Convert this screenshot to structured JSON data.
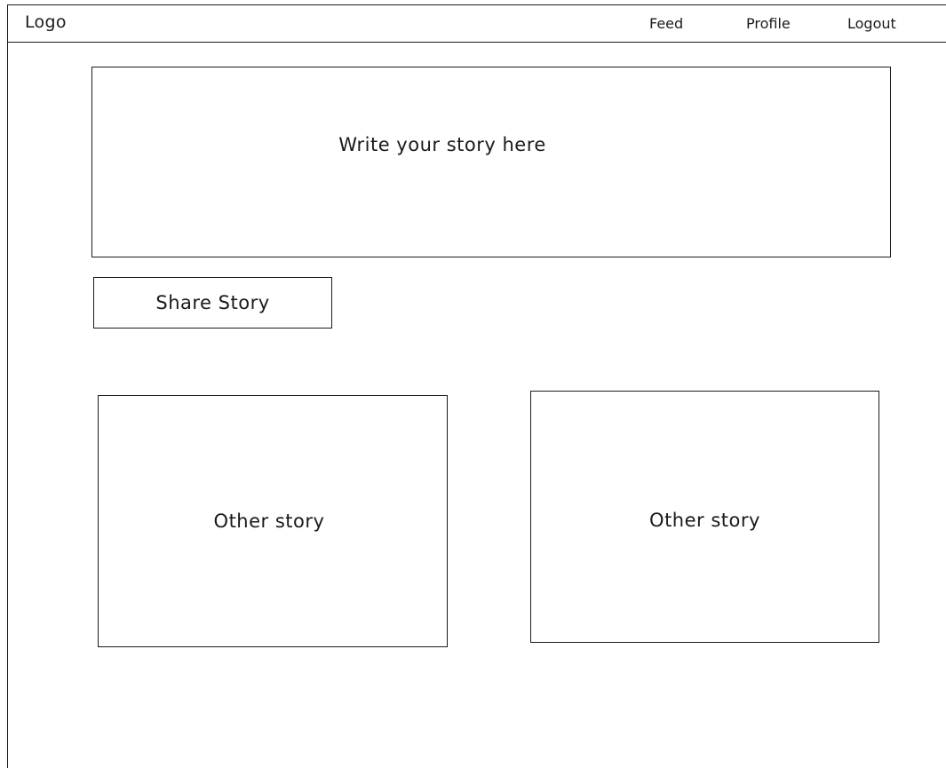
{
  "navbar": {
    "logo": "Logo",
    "links": [
      {
        "label": "Feed"
      },
      {
        "label": "Profile"
      },
      {
        "label": "Logout"
      }
    ]
  },
  "composer": {
    "placeholder": "Write your story here",
    "share_label": "Share Story"
  },
  "feed": {
    "stories": [
      {
        "text": "Other story"
      },
      {
        "text": "Other story"
      }
    ]
  }
}
